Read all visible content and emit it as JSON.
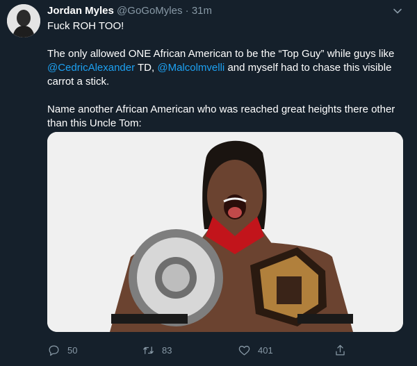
{
  "tweet": {
    "author_name": "Jordan Myles",
    "handle": "@GoGoMyles",
    "separator": "·",
    "time": "31m",
    "line1": "Fuck ROH TOO!",
    "p2_a": "The only allowed ONE African American to be the “Top Guy” while guys like ",
    "mention1": "@CedricAlexander",
    "p2_b": " TD, ",
    "mention2": "@Malcolmvelli",
    "p2_c": " and myself had to chase this visible carrot a stick.",
    "p3": "Name another African American who was reached great heights there other than this Uncle Tom:"
  },
  "actions": {
    "replies": "50",
    "retweets": "83",
    "likes": "401"
  },
  "colors": {
    "background": "#15202b",
    "secondary_text": "#8899a6",
    "link": "#1da1f2"
  },
  "icons": [
    "chevron-down-icon",
    "reply-icon",
    "retweet-icon",
    "like-icon",
    "share-icon"
  ]
}
